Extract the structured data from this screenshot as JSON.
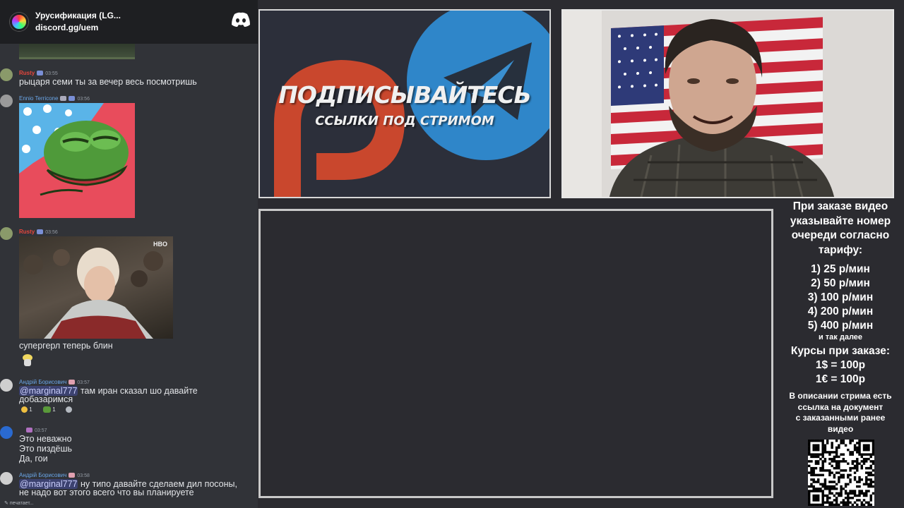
{
  "discord": {
    "server_name": "Урусификация (LG...",
    "server_link": "discord.gg/uem",
    "typing": "печатает...",
    "messages": [
      {
        "user": "Rusty",
        "time": "03:55",
        "text": "рыцаря семи ты за вечер весь посмотришь",
        "user_color": "#e8463c"
      },
      {
        "user": "Ennio Terricone",
        "time": "03:56",
        "text": "",
        "user_color": "#6aa6e8"
      },
      {
        "user": "Rusty",
        "time": "03:56",
        "text": "супергерл теперь блин",
        "user_color": "#e8463c",
        "image_badge": "HBO"
      },
      {
        "user": "Андрій Борисович",
        "time": "03:57",
        "mention": "@marginal777",
        "text": "там иран сказал шо давайте",
        "text2": "добазаримся",
        "user_color": "#6aa6e8",
        "reactions": [
          "1",
          "1"
        ]
      },
      {
        "user": "",
        "time": "03:57",
        "lines": [
          "Это неважно",
          "Это пиздёшь",
          "Да, гои"
        ]
      },
      {
        "user": "Андрій Борисович",
        "time": "03:58",
        "mention": "@marginal777",
        "text": "ну типо давайте сделаем дил посоны,",
        "text2": "не надо вот этого всего что вы планируете",
        "user_color": "#6aa6e8"
      }
    ]
  },
  "promo": {
    "title": "ПОДПИСЫВАЙТЕСЬ",
    "subtitle": "ССЫЛКИ ПОД СТРИМОМ"
  },
  "info": {
    "heading": [
      "При заказе видео",
      "указывайте номер",
      "очереди согласно",
      "тарифу:"
    ],
    "tariffs": [
      "1) 25 р/мин",
      "2) 50 р/мин",
      "3) 100 р/мин",
      "4) 200 р/мин",
      "5) 400 р/мин"
    ],
    "etc": "и так далее",
    "rates_title": "Курсы при заказе:",
    "rates": [
      "1$ = 100р",
      "1€ = 100р"
    ],
    "note": [
      "В описании стрима есть",
      "ссылка на документ",
      "с заказанными ранее",
      "видео"
    ]
  },
  "colors": {
    "patreon": "#c9472d",
    "telegram": "#2f86c9",
    "discord_bg": "#313338"
  }
}
